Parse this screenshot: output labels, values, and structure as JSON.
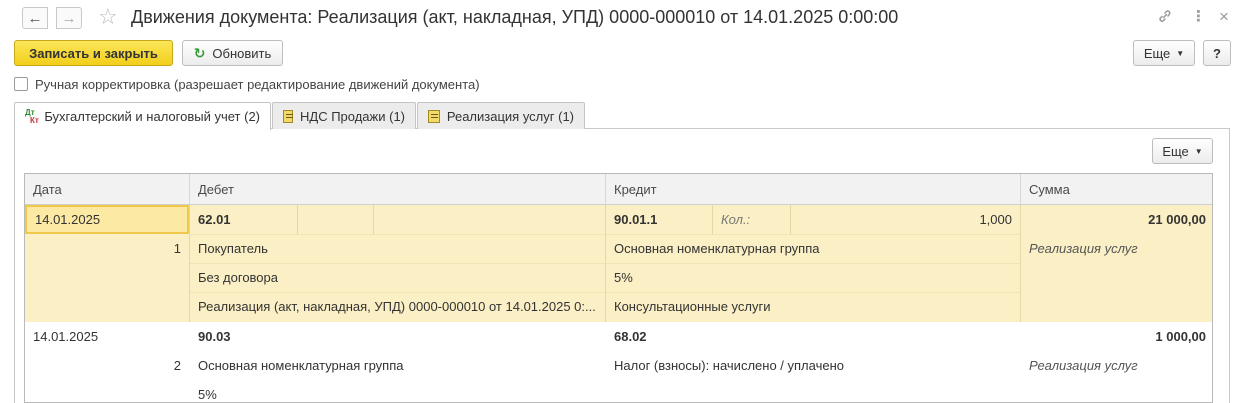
{
  "window": {
    "title": "Движения документа: Реализация (акт, накладная, УПД) 0000-000010 от 14.01.2025 0:00:00",
    "back_icon": "←",
    "forward_icon": "→",
    "star_icon": "☆",
    "link_icon": "🔗",
    "more_icon": "⋮",
    "close_icon": "×"
  },
  "toolbar": {
    "save_close_label": "Записать и закрыть",
    "refresh_label": "Обновить",
    "refresh_icon": "↻",
    "more_label": "Еще",
    "help_label": "?"
  },
  "manual_correction": {
    "label": "Ручная корректировка (разрешает редактирование движений документа)",
    "checked": false
  },
  "tabs": [
    {
      "label": "Бухгалтерский и налоговый учет (2)",
      "active": true
    },
    {
      "label": "НДС Продажи (1)",
      "active": false
    },
    {
      "label": "Реализация услуг (1)",
      "active": false
    }
  ],
  "table_toolbar": {
    "more_label": "Еще"
  },
  "table": {
    "columns": [
      "Дата",
      "Дебет",
      "Кредит",
      "Сумма"
    ],
    "rows": [
      {
        "date": "14.01.2025",
        "number": "1",
        "debit_account": "62.01",
        "debit_sub": [
          "Покупатель",
          "Без договора",
          "Реализация (акт, накладная, УПД) 0000-000010 от 14.01.2025 0:..."
        ],
        "credit_account": "90.01.1",
        "qty_label": "Кол.:",
        "qty_value": "1,000",
        "credit_sub": [
          "Основная номенклатурная группа",
          "5%",
          "Консультационные услуги"
        ],
        "amount": "21 000,00",
        "content": "Реализация услуг"
      },
      {
        "date": "14.01.2025",
        "number": "2",
        "debit_account": "90.03",
        "debit_sub": [
          "Основная номенклатурная группа",
          "5%"
        ],
        "credit_account": "68.02",
        "credit_sub": [
          "Налог (взносы): начислено / уплачено"
        ],
        "amount": "1 000,00",
        "content": "Реализация услуг"
      }
    ]
  }
}
